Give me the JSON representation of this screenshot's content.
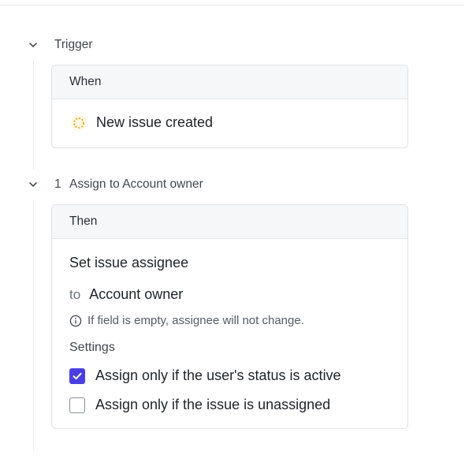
{
  "trigger": {
    "section_title": "Trigger",
    "card_header": "When",
    "event": "New issue created",
    "icons": {
      "collapse": "chevron-down-icon",
      "event": "spinner-icon"
    }
  },
  "step": {
    "number": "1",
    "section_title": "Assign to Account owner",
    "card_header": "Then",
    "action_title": "Set issue assignee",
    "to_label": "to",
    "to_value": "Account owner",
    "hint": "If field is empty, assignee will not change.",
    "settings_label": "Settings",
    "options": [
      {
        "label": "Assign only if the user's status is active",
        "checked": true
      },
      {
        "label": "Assign only if the issue is unassigned",
        "checked": false
      }
    ],
    "icons": {
      "collapse": "chevron-down-icon",
      "hint": "info-icon",
      "check": "check-icon"
    }
  },
  "colors": {
    "accent": "#4a3fe0",
    "trigger_icon": "#e0a106"
  }
}
